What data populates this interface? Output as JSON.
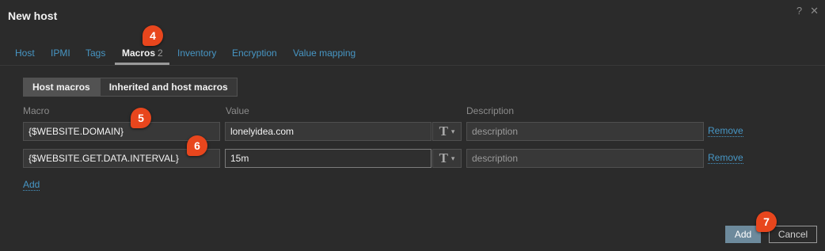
{
  "dialog": {
    "title": "New host",
    "help_icon": "?",
    "close_icon": "✕"
  },
  "tabs": [
    {
      "label": "Host"
    },
    {
      "label": "IPMI"
    },
    {
      "label": "Tags"
    },
    {
      "label": "Macros",
      "count": "2"
    },
    {
      "label": "Inventory"
    },
    {
      "label": "Encryption"
    },
    {
      "label": "Value mapping"
    }
  ],
  "badges": [
    "4",
    "5",
    "6",
    "7"
  ],
  "segmented": {
    "host_macros": "Host macros",
    "inherited": "Inherited and host macros"
  },
  "columns": {
    "macro": "Macro",
    "value": "Value",
    "description": "Description"
  },
  "rows": [
    {
      "macro": "{$WEBSITE.DOMAIN}",
      "value": "lonelyidea.com",
      "type_icon": "T",
      "description_placeholder": "description",
      "remove": "Remove"
    },
    {
      "macro": "{$WEBSITE.GET.DATA.INTERVAL}",
      "value": "15m",
      "type_icon": "T",
      "description_placeholder": "description",
      "remove": "Remove"
    }
  ],
  "add_link": "Add",
  "footer": {
    "add_button": "Add",
    "cancel_button": "Cancel"
  },
  "colors": {
    "background": "#2b2b2b",
    "link": "#4796c4",
    "badge": "#e8461d",
    "primary_button": "#6d8a9c"
  }
}
